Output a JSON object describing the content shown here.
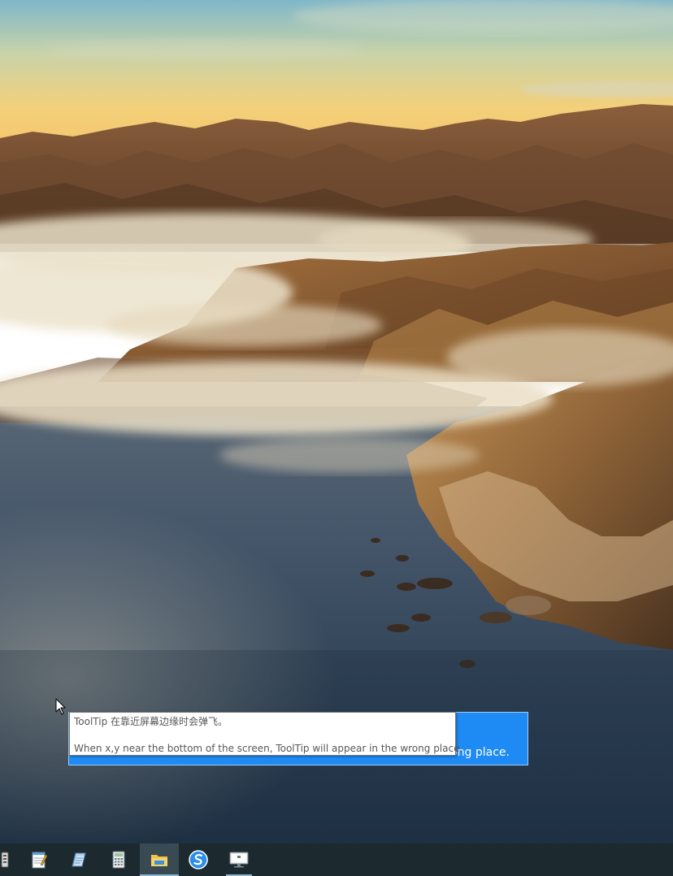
{
  "tooltip": {
    "line_zh": "ToolTip 在靠近屏幕边缘时会弹飞。",
    "line_en": "When x,y near the bottom of the screen, ToolTip will appear in the wrong place."
  },
  "blue_window": {
    "visible_text": "ong place.",
    "color": "#1e8bf5"
  },
  "taskbar": {
    "items": [
      {
        "icon": "app-icon-partial"
      },
      {
        "icon": "notepad-icon"
      },
      {
        "icon": "wordpad-icon"
      },
      {
        "icon": "calculator-icon"
      },
      {
        "icon": "file-explorer-icon",
        "active": true
      },
      {
        "icon": "sogou-browser-icon"
      },
      {
        "icon": "remote-desktop-icon",
        "running": true
      }
    ],
    "color": "#1c2a30"
  },
  "wallpaper": {
    "name": "Big Sur coastline"
  }
}
